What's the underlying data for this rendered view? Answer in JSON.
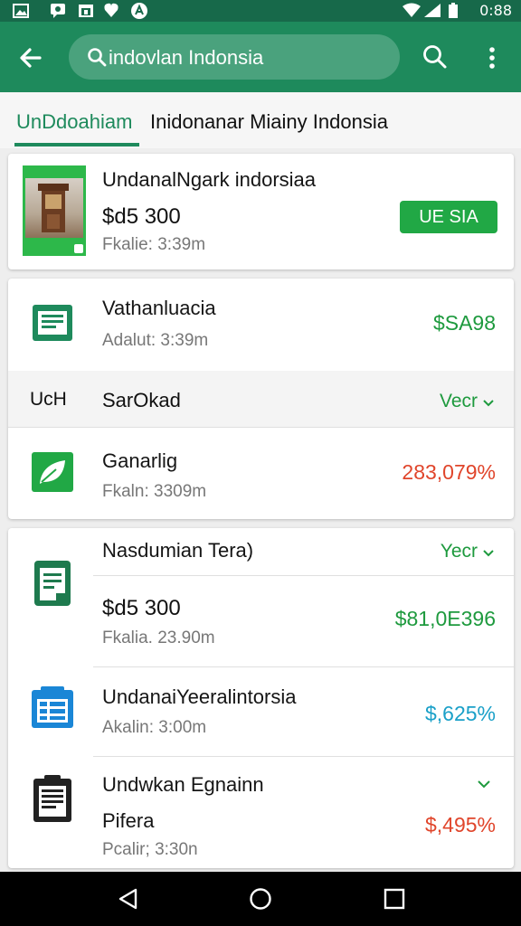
{
  "status_bar": {
    "time": "0:88",
    "icons": [
      "gallery-icon",
      "messenger-icon",
      "calendar-icon",
      "location-icon",
      "settings-icon",
      "wifi-icon",
      "signal-icon",
      "battery-icon"
    ]
  },
  "app_bar": {
    "search_text": "indovlan Indonsia",
    "colors": {
      "bar": "#1e8a5c",
      "status": "#17694a",
      "search_field": "#4aa27d"
    }
  },
  "tabs": {
    "active_label": "UnDdoahiam",
    "page_title": "Inidonanar Miainy Indonsia"
  },
  "featured": {
    "title": "UndanalNgark indorsiaa",
    "price": "$d5 300",
    "meta": "Fkalie: 3:39m",
    "button_label": "UE SIA"
  },
  "card_two": {
    "first": {
      "title": "Vathanluacia",
      "meta": "Adalut: 3:39m",
      "amount": "$SA98",
      "icon": "document-icon"
    },
    "section": {
      "abbr": "UcH",
      "title": "SarOkad",
      "link": "Vecr"
    },
    "second": {
      "title": "Ganarlig",
      "meta": "Fkaln: 3309m",
      "amount": "283,079%",
      "icon": "leaf-icon"
    }
  },
  "card_three": {
    "section_title": "Nasdumian Tera)",
    "section_link": "Yecr",
    "items": [
      {
        "title": "$d5 300",
        "meta": "Fkalia. 23.90m",
        "amount": "$81,0E396",
        "icon": "notes-icon"
      },
      {
        "title": "UndanaiYeeralintorsia",
        "meta": "Akalin: 3:00m",
        "amount": "$,625%",
        "icon": "calendar-doc-icon"
      },
      {
        "title": "Undwkan Egnainn",
        "subtitle": "Pifera",
        "meta": "Pcalir; 3:30n",
        "amount": "$,495%",
        "icon": "clipboard-icon"
      }
    ]
  },
  "nav_bar": {
    "buttons": [
      "back-nav-icon",
      "home-nav-icon",
      "recents-nav-icon"
    ]
  }
}
